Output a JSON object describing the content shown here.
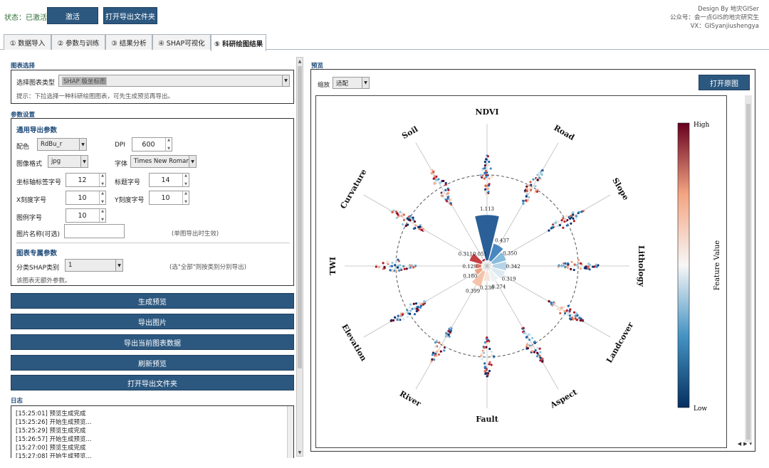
{
  "status": {
    "text": "状态：已激活",
    "color": "#2e6b33"
  },
  "toolbar": {
    "activate_label": "激活",
    "open_export_folder_label": "打开导出文件夹"
  },
  "credits": {
    "line1": "Design By 地灾GISer",
    "line2": "公众号：会一点GIS的地灾研究生",
    "line3": "VX：GISyanjiushengya"
  },
  "tabs": [
    {
      "label": "① 数据导入"
    },
    {
      "label": "② 参数与训练"
    },
    {
      "label": "③ 结果分析"
    },
    {
      "label": "④ SHAP可视化"
    },
    {
      "label": "⑤ 科研绘图结果"
    }
  ],
  "chart_select": {
    "section_title": "图表选择",
    "type_label": "选择图表类型",
    "type_value": "SHAP 极坐标图",
    "hint": "提示：下拉选择一种科研绘图图表，可先生成预览再导出。"
  },
  "params": {
    "section_title": "参数设置",
    "common_title": "通用导出参数",
    "colormap_label": "配色",
    "colormap_value": "RdBu_r",
    "dpi_label": "DPI",
    "dpi_value": "600",
    "format_label": "图像格式",
    "format_value": "jpg",
    "font_label": "字体",
    "font_value": "Times New Roman",
    "axis_label_size_label": "坐标轴标签字号",
    "axis_label_size_value": "12",
    "title_size_label": "标题字号",
    "title_size_value": "14",
    "xtick_size_label": "X刻度字号",
    "xtick_size_value": "10",
    "ytick_size_label": "Y刻度字号",
    "ytick_size_value": "10",
    "legend_size_label": "图例字号",
    "legend_size_value": "10",
    "filename_label": "图片名称(可选)",
    "filename_value": "",
    "filename_hint": "(单图导出时生效)",
    "specific_title": "图表专属参数",
    "shap_class_label": "分类SHAP类别",
    "shap_class_value": "1",
    "shap_class_hint": "(选\"全部\"则按类别分别导出)",
    "no_extra_params": "该图表无额外参数。"
  },
  "actions": {
    "generate_preview": "生成预览",
    "export_image": "导出图片",
    "export_chart_data": "导出当前图表数据",
    "refresh_preview": "刷新预览",
    "open_export_folder": "打开导出文件夹"
  },
  "log": {
    "title": "日志",
    "lines": [
      "[15:25:01] 预览生成完成",
      "[15:25:26] 开始生成预览...",
      "[15:25:29] 预览生成完成",
      "[15:26:57] 开始生成预览...",
      "[15:27:00] 预览生成完成",
      "[15:27:08] 开始生成预览..."
    ]
  },
  "preview": {
    "title": "预览",
    "zoom_label": "缩放",
    "zoom_value": "适配",
    "open_original_label": "打开原图"
  },
  "colors": {
    "primary_button": "#2c5880",
    "section_title": "#1f4b7a"
  },
  "chart_data": {
    "type": "polar-bar",
    "categories": [
      "NDVI",
      "Road",
      "Slope",
      "Lithology",
      "Landcover",
      "Aspect",
      "Fault",
      "River",
      "Elevation",
      "TWI",
      "Curvature",
      "Soil"
    ],
    "values": [
      1.113,
      0.437,
      0.35,
      0.342,
      0.319,
      0.274,
      0.23,
      0.399,
      0.18,
      0.129,
      0.311,
      0.051
    ],
    "colorbar": {
      "label": "Feature Value",
      "high": "High",
      "low": "Low"
    }
  }
}
